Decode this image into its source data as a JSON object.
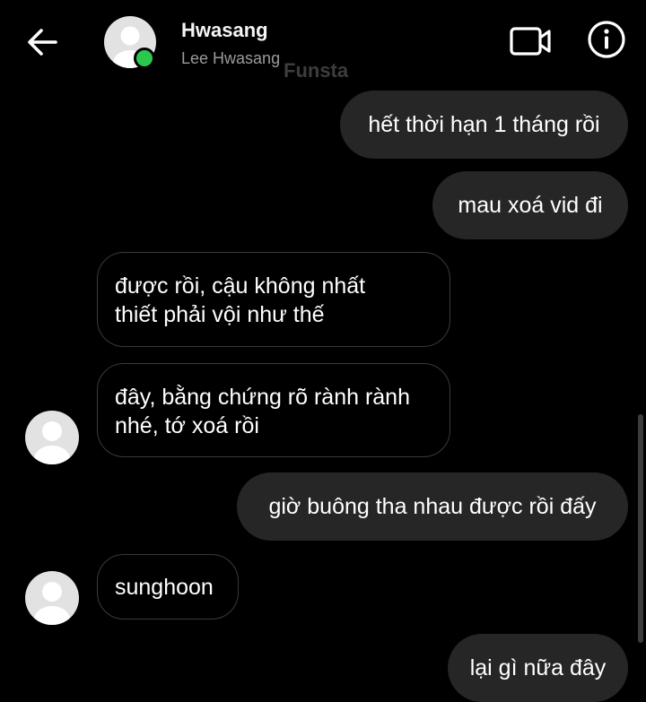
{
  "header": {
    "name": "Hwasang",
    "username": "Lee Hwasang",
    "watermark": "Funsta",
    "icons": {
      "back": "arrow-left-icon",
      "video": "video-camera-icon",
      "info": "info-icon"
    },
    "online_color": "#2cc84d"
  },
  "messages": [
    {
      "from": "me",
      "text": "hết thời hạn 1 tháng rồi"
    },
    {
      "from": "me",
      "text": "mau xoá vid đi"
    },
    {
      "from": "them",
      "line1": "được rồi, cậu không nhất",
      "line2": "thiết phải vội như thế"
    },
    {
      "from": "them",
      "line1": "đây, bằng chứng rõ rành rành",
      "line2": "nhé, tớ xoá rồi"
    },
    {
      "from": "me",
      "text": "giờ buông tha nhau được rồi đấy"
    },
    {
      "from": "them",
      "text": "sunghoon"
    },
    {
      "from": "me",
      "text": "lại gì nữa đây"
    }
  ],
  "colors": {
    "sent_bubble": "#262626",
    "received_border": "#3a3a3a",
    "background": "#000000"
  }
}
